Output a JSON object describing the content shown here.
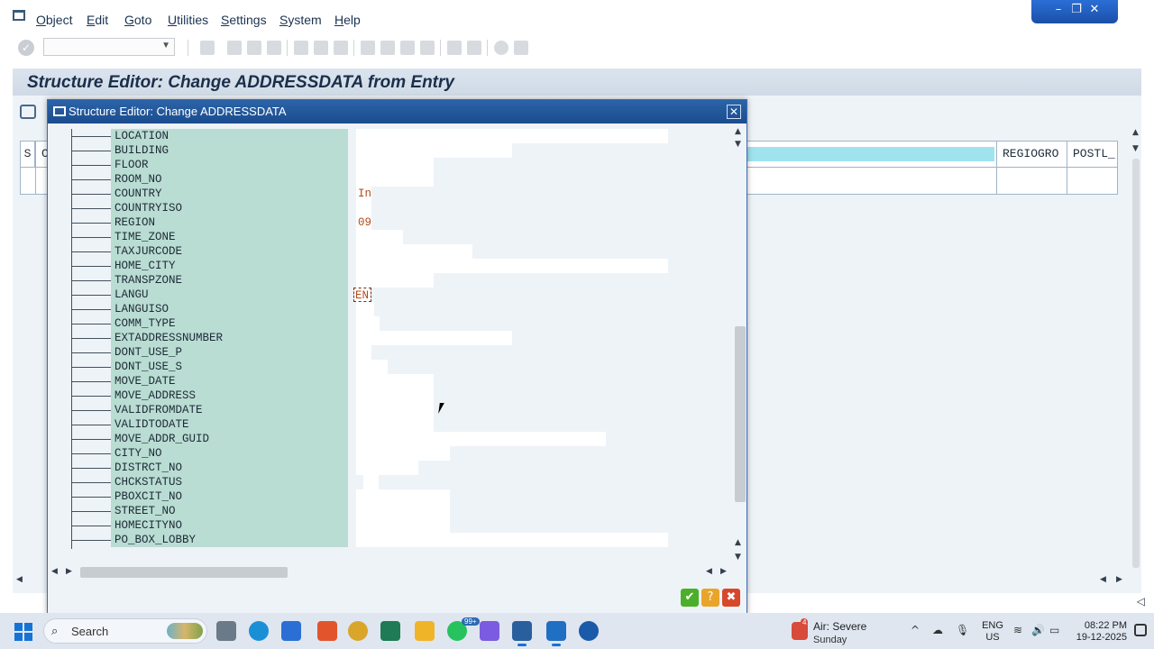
{
  "menu": {
    "items": [
      "Object",
      "Edit",
      "Goto",
      "Utilities",
      "Settings",
      "System",
      "Help"
    ]
  },
  "window_controls": {
    "minimize": "–",
    "restore": "❐",
    "close": "✕"
  },
  "toolbar": {
    "command_field_value": ""
  },
  "main": {
    "title": "Structure Editor: Change ADDRESSDATA from Entry",
    "grid": {
      "col_s": "S",
      "col_c": "C",
      "col_regiogro": "REGIOGRO",
      "col_postl": "POSTL_"
    }
  },
  "dialog": {
    "title": "Structure Editor: Change ADDRESSDATA",
    "close_label": "✕",
    "fields": [
      {
        "name": "LOCATION",
        "value": ""
      },
      {
        "name": "BUILDING",
        "value": ""
      },
      {
        "name": "FLOOR",
        "value": ""
      },
      {
        "name": "ROOM_NO",
        "value": ""
      },
      {
        "name": "COUNTRY",
        "value": "In"
      },
      {
        "name": "COUNTRYISO",
        "value": ""
      },
      {
        "name": "REGION",
        "value": "09"
      },
      {
        "name": "TIME_ZONE",
        "value": ""
      },
      {
        "name": "TAXJURCODE",
        "value": ""
      },
      {
        "name": "HOME_CITY",
        "value": ""
      },
      {
        "name": "TRANSPZONE",
        "value": ""
      },
      {
        "name": "LANGU",
        "value": "EN"
      },
      {
        "name": "LANGUISO",
        "value": ""
      },
      {
        "name": "COMM_TYPE",
        "value": ""
      },
      {
        "name": "EXTADDRESSNUMBER",
        "value": ""
      },
      {
        "name": "DONT_USE_P",
        "value": ""
      },
      {
        "name": "DONT_USE_S",
        "value": ""
      },
      {
        "name": "MOVE_DATE",
        "value": ""
      },
      {
        "name": "MOVE_ADDRESS",
        "value": ""
      },
      {
        "name": "VALIDFROMDATE",
        "value": ""
      },
      {
        "name": "VALIDTODATE",
        "value": ""
      },
      {
        "name": "MOVE_ADDR_GUID",
        "value": ""
      },
      {
        "name": "CITY_NO",
        "value": ""
      },
      {
        "name": "DISTRCT_NO",
        "value": ""
      },
      {
        "name": "CHCKSTATUS",
        "value": ""
      },
      {
        "name": "PBOXCIT_NO",
        "value": ""
      },
      {
        "name": "STREET_NO",
        "value": ""
      },
      {
        "name": "HOMECITYNO",
        "value": ""
      },
      {
        "name": "PO_BOX_LOBBY",
        "value": ""
      }
    ],
    "footer": {
      "confirm": "✔",
      "help": "?",
      "cancel": "✖"
    }
  },
  "taskbar": {
    "search_label": "Search",
    "badge": "99+",
    "weather": {
      "count": "4",
      "line1": "Air: Severe",
      "line2": "Sunday"
    },
    "language": {
      "line1": "ENG",
      "line2": "US"
    },
    "clock": {
      "time": "08:22 PM",
      "date": "19-12-2025"
    }
  },
  "colors": {
    "accent": "#1a4c8e",
    "field_name_bg": "#b9dcd3",
    "value_text": "#b34a1a",
    "header_highlight": "#9fe3ef"
  }
}
